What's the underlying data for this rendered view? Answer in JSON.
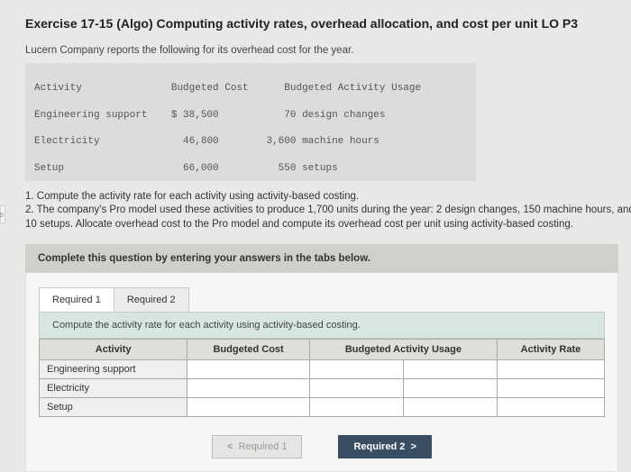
{
  "title": "Exercise 17-15 (Algo) Computing activity rates, overhead allocation, and cost per unit LO P3",
  "intro": "Lucern Company reports the following for its overhead cost for the year.",
  "data_block": {
    "head_activity": "Activity",
    "head_cost": "Budgeted Cost",
    "head_usage": "Budgeted Activity Usage",
    "rows": [
      {
        "activity": "Engineering support",
        "cost": "$ 38,500",
        "usage": "70 design changes"
      },
      {
        "activity": "Electricity",
        "cost": "46,800",
        "usage": "3,600 machine hours"
      },
      {
        "activity": "Setup",
        "cost": "66,000",
        "usage": "550 setups"
      }
    ]
  },
  "questions": {
    "q1": "1. Compute the activity rate for each activity using activity-based costing.",
    "q2": "2. The company's Pro model used these activities to produce 1,700 units during the year: 2 design changes, 150 machine hours, and 10 setups. Allocate overhead cost to the Pro model and compute its overhead cost per unit using activity-based costing."
  },
  "left_stub": "ces",
  "complete_bar": "Complete this question by entering your answers in the tabs below.",
  "tabs": [
    {
      "label": "Required 1"
    },
    {
      "label": "Required 2"
    }
  ],
  "subprompt": "Compute the activity rate for each activity using activity-based costing.",
  "worktable": {
    "headers": [
      "Activity",
      "Budgeted Cost",
      "Budgeted Activity Usage",
      "Activity Rate"
    ],
    "row_labels": [
      "Engineering support",
      "Electricity",
      "Setup"
    ]
  },
  "nav": {
    "prev": "Required 1",
    "next": "Required 2"
  }
}
